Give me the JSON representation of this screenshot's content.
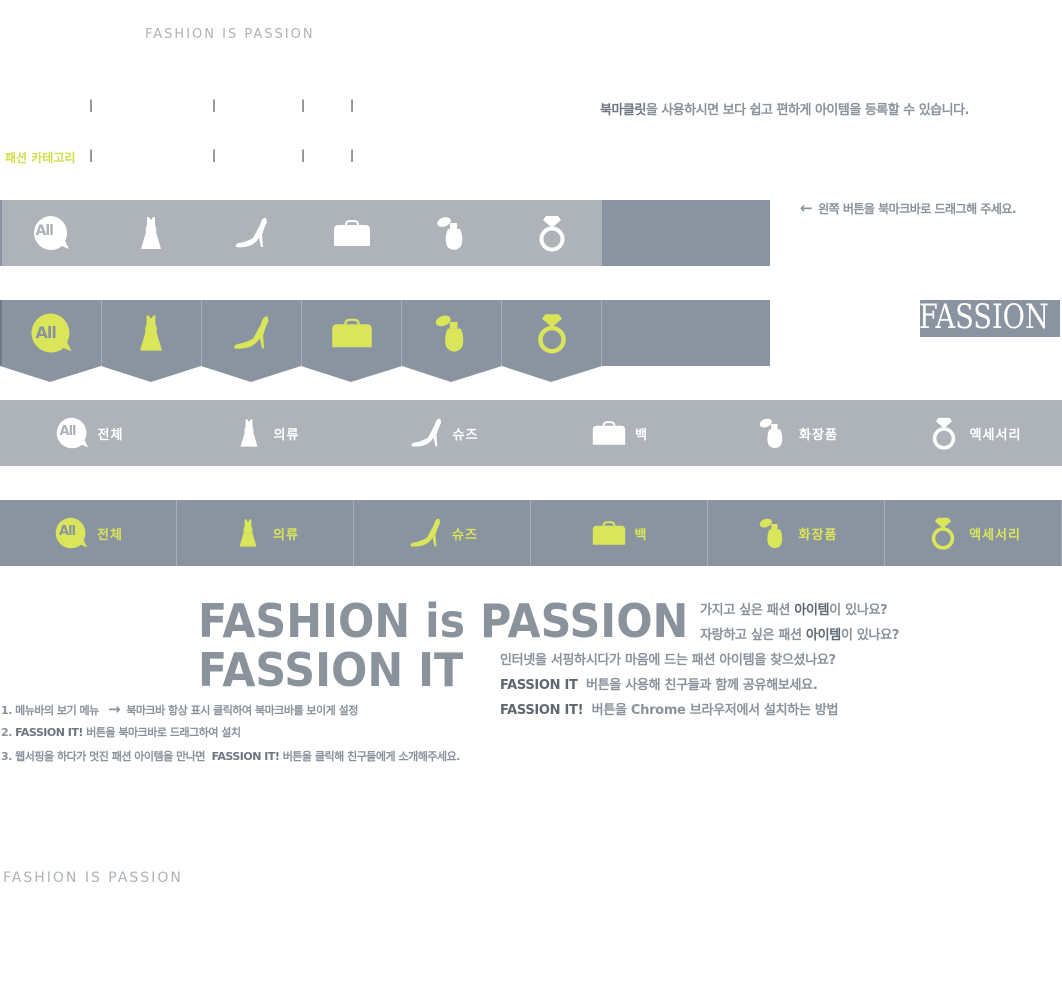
{
  "tagline": "FASHION IS PASSION",
  "notice": {
    "bold": "북마클릿",
    "rest": "을 사용하시면 보다 쉽고 편하게 아이템을 등록할 수 있습니다."
  },
  "category_heading": "패션 카테고리",
  "separator": "|",
  "drag_hint": "왼쪽 버튼을 북마크바로 드래그해 주세요.",
  "logo_text": "FASSION",
  "categories": [
    {
      "icon": "all-icon",
      "label": "전체"
    },
    {
      "icon": "dress-icon",
      "label": "의류"
    },
    {
      "icon": "heel-icon",
      "label": "슈즈"
    },
    {
      "icon": "bag-icon",
      "label": "백"
    },
    {
      "icon": "perfume-icon",
      "label": "화장품"
    },
    {
      "icon": "ring-icon",
      "label": "액세서리"
    }
  ],
  "all_badge": "All",
  "colors": {
    "gray_light": "#adb3b9",
    "gray_dark": "#8994a0",
    "accent": "#dbe55a",
    "text": "#8a939c",
    "white": "#ffffff"
  },
  "headline1": "FASHION is PASSION",
  "headline2": "FASSION IT",
  "questions": [
    {
      "pre": "가지고 싶은 패션 ",
      "bold": "아이템",
      "post": "이 있나요?"
    },
    {
      "pre": "자랑하고 싶은 패션 ",
      "bold": "아이템",
      "post": "이 있나요?"
    }
  ],
  "desc": [
    {
      "pre": "",
      "bold": "",
      "post": "인터넷을 서핑하시다가 마음에 드는 패션 아이템을 찾으셨나요?"
    },
    {
      "pre": "",
      "bold": "FASSION IT",
      "post": "  버튼을 사용해 친구들과 함께 공유해보세요."
    },
    {
      "pre": "",
      "bold": "FASSION IT!",
      "post": "  버튼을 Chrome 브라우저에서 설치하는 방법"
    }
  ],
  "steps": [
    {
      "num": "1. ",
      "bold": "",
      "text": "메뉴바의 보기 메뉴",
      "arrow": "→",
      "after": "북마크바 항상 표시 클릭하여 북마크바를 보이게 설정"
    },
    {
      "num": "2. ",
      "bold": "FASSION IT!",
      "text": " 버튼을 북마크바로 드래그하여 설치",
      "arrow": "",
      "after": ""
    },
    {
      "num": "3. ",
      "bold": "FASSION IT!",
      "text": "웹서핑을 하다가 멋진 패션 아이템을 만나면  ",
      "arrow": "",
      "after": " 버튼을 클릭해 친구들에게 소개해주세요."
    }
  ],
  "footer_tagline": "FASHION IS PASSION"
}
